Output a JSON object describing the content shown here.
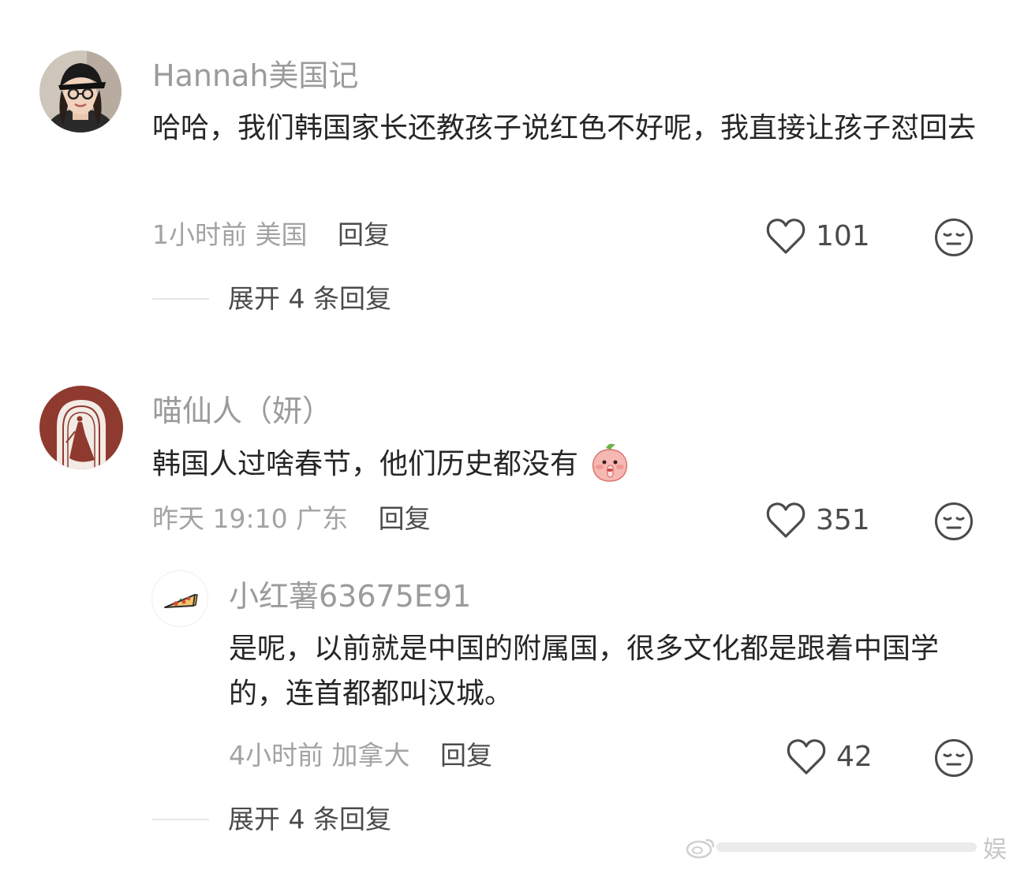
{
  "comments": [
    {
      "username": "Hannah美国记",
      "text": "哈哈，我们韩国家长还教孩子说红色不好呢，我直接让孩子怼回去",
      "time": "1小时前",
      "location": "美国",
      "reply_label": "回复",
      "likes": "101",
      "expand_label": "展开 4 条回复"
    },
    {
      "username": "喵仙人（妍）",
      "text": "韩国人过啥春节，他们历史都没有",
      "time": "昨天 19:10",
      "location": "广东",
      "reply_label": "回复",
      "likes": "351",
      "reply": {
        "username": "小红薯63675E91",
        "text": "是呢，以前就是中国的附属国，很多文化都是跟着中国学的，连首都都叫汉城。",
        "time": "4小时前",
        "location": "加拿大",
        "reply_label": "回复",
        "likes": "42"
      },
      "expand_label": "展开 4 条回复"
    }
  ],
  "watermark": "娱",
  "icons": {
    "like": "heart-outline-icon",
    "dislike": "meh-face-icon",
    "emoji": "shush-peach-emoji-icon"
  },
  "colors": {
    "username": "#9b9b9b",
    "text": "#262626",
    "meta": "#a3a3a3",
    "action": "#4b4b4b"
  }
}
